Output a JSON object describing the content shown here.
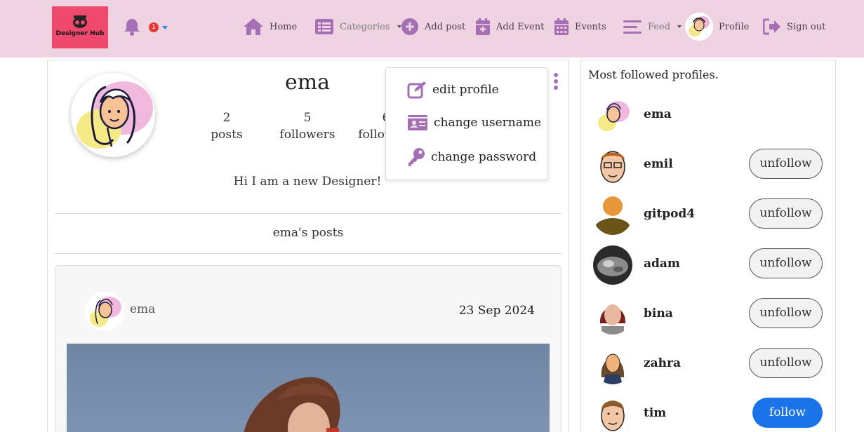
{
  "navbar": {
    "logo_text": "Designer Hub",
    "notification_count": "1",
    "items": [
      {
        "label": "Home",
        "icon": "home-icon"
      },
      {
        "label": "Categories",
        "icon": "list-icon"
      },
      {
        "label": "Add post",
        "icon": "plus-circle-icon"
      },
      {
        "label": "Add Event",
        "icon": "calendar-plus-icon"
      },
      {
        "label": "Events",
        "icon": "calendar-icon"
      },
      {
        "label": "Feed",
        "icon": "menu-icon"
      },
      {
        "label": "Profile",
        "icon": "avatar"
      },
      {
        "label": "Sign out",
        "icon": "sign-out-icon"
      }
    ],
    "accent_color": "#a56fb6",
    "background_color": "#f0d3e3"
  },
  "profile": {
    "username": "ema",
    "stats": [
      {
        "value": "2",
        "label": "posts"
      },
      {
        "value": "5",
        "label": "followers"
      },
      {
        "value": "6",
        "label": "following"
      }
    ],
    "bio": "Hi I am a new Designer!",
    "posts_section_title": "ema's posts"
  },
  "dropdown": {
    "items": [
      {
        "label": "edit profile",
        "icon": "edit-icon"
      },
      {
        "label": "change username",
        "icon": "id-card-icon"
      },
      {
        "label": "change password",
        "icon": "key-icon"
      }
    ]
  },
  "post": {
    "author": "ema",
    "date": "23 Sep 2024"
  },
  "sidebar": {
    "title": "Most followed profiles.",
    "profiles": [
      {
        "name": "ema",
        "button": ""
      },
      {
        "name": "emil",
        "button": "unfollow"
      },
      {
        "name": "gitpod4",
        "button": "unfollow"
      },
      {
        "name": "adam",
        "button": "unfollow"
      },
      {
        "name": "bina",
        "button": "unfollow"
      },
      {
        "name": "zahra",
        "button": "unfollow"
      },
      {
        "name": "tim",
        "button": "follow"
      }
    ],
    "follow_color": "#1a73e8"
  }
}
